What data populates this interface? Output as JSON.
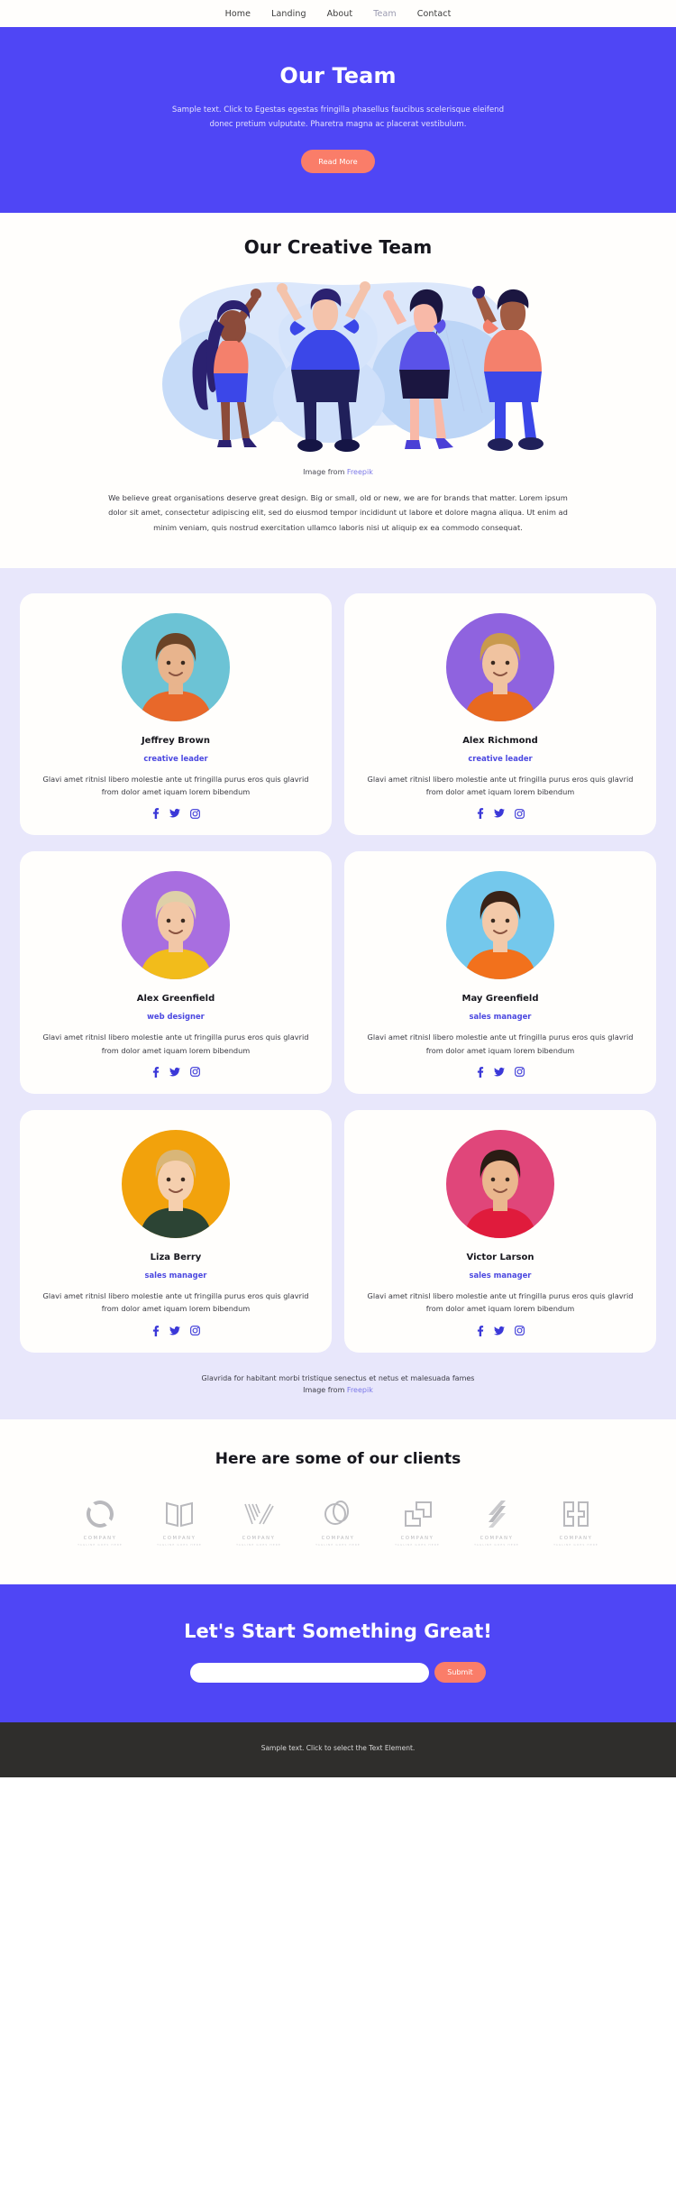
{
  "nav": {
    "items": [
      {
        "label": "Home",
        "active": false
      },
      {
        "label": "Landing",
        "active": false
      },
      {
        "label": "About",
        "active": false
      },
      {
        "label": "Team",
        "active": true
      },
      {
        "label": "Contact",
        "active": false
      }
    ]
  },
  "hero": {
    "title": "Our Team",
    "paragraph": "Sample text. Click to Egestas egestas fringilla phasellus faucibus scelerisque eleifend donec pretium vulputate. Pharetra magna ac placerat vestibulum.",
    "button": "Read More"
  },
  "creative": {
    "title": "Our Creative Team",
    "credit_prefix": "Image from",
    "credit_link": "Freepik",
    "paragraph": "We believe great organisations deserve great design. Big or small, old or new, we are for brands that matter. Lorem ipsum dolor sit amet, consectetur adipiscing elit, sed do eiusmod tempor incididunt ut labore et dolore magna aliqua. Ut enim ad minim veniam, quis nostrud exercitation ullamco laboris nisi ut aliquip ex ea commodo consequat."
  },
  "team": {
    "bio": "Glavi amet ritnisl libero molestie ante ut fringilla purus eros quis glavrid from dolor amet iquam lorem bibendum",
    "members": [
      {
        "name": "Jeffrey Brown",
        "role": "creative leader",
        "bg": "#6cc3d5",
        "skin": "#e8b48d",
        "shirt": "#e8682a",
        "hair": "#6b4326"
      },
      {
        "name": "Alex Richmond",
        "role": "creative leader",
        "bg": "#8f63df",
        "skin": "#f0c3a0",
        "shirt": "#e8691f",
        "hair": "#c99a4e"
      },
      {
        "name": "Alex Greenfield",
        "role": "web designer",
        "bg": "#a86ee0",
        "skin": "#f2c7a6",
        "shirt": "#f2bc1b",
        "hair": "#ded0a8"
      },
      {
        "name": "May Greenfield",
        "role": "sales manager",
        "bg": "#74c8ec",
        "skin": "#f3c9a9",
        "shirt": "#f2711c",
        "hair": "#3a2317"
      },
      {
        "name": "Liza Berry",
        "role": "sales manager",
        "bg": "#f2a20c",
        "skin": "#f5cfae",
        "shirt": "#2c4434",
        "hair": "#d9b678"
      },
      {
        "name": "Victor Larson",
        "role": "sales manager",
        "bg": "#e0467a",
        "skin": "#eab78e",
        "shirt": "#e01b3c",
        "hair": "#2a1c14"
      }
    ],
    "social_icons": [
      "facebook-icon",
      "twitter-icon",
      "instagram-icon"
    ],
    "footer_line": "Glavrida for habitant morbi tristique senectus et netus et malesuada fames",
    "footer_credit_prefix": "Image from",
    "footer_credit_link": "Freepik"
  },
  "clients": {
    "title": "Here are some of our clients",
    "logos": [
      {
        "mark": "lens-mark",
        "name": "COMPANY",
        "tagline": "TAGLINE GOES HERE"
      },
      {
        "mark": "book-mark",
        "name": "COMPANY",
        "tagline": "TAGLINE GOES HERE"
      },
      {
        "mark": "chevrons-mark",
        "name": "COMPANY",
        "tagline": "TAGLINE GOES HERE"
      },
      {
        "mark": "loop-mark",
        "name": "COMPANY",
        "tagline": "TAGLINE GOES HERE"
      },
      {
        "mark": "corners-mark",
        "name": "COMPANY",
        "tagline": "TAGLINE GOES HERE"
      },
      {
        "mark": "slashes-mark",
        "name": "COMPANY",
        "tagline": "TAGLINE GOES HERE"
      },
      {
        "mark": "blocks-mark",
        "name": "COMPANY",
        "tagline": "TAGLINE GOES HERE"
      }
    ]
  },
  "cta": {
    "title": "Let's Start Something Great!",
    "input_value": "",
    "input_placeholder": "",
    "button": "Submit"
  },
  "footer": {
    "text": "Sample text. Click to select the Text Element."
  },
  "colors": {
    "brand_blue": "#4f46f5",
    "accent_coral": "#fa7d69",
    "lavender_bg": "#e8e7fb",
    "role_purple": "#4b48e0",
    "footer_dark": "#2f2e2c"
  }
}
